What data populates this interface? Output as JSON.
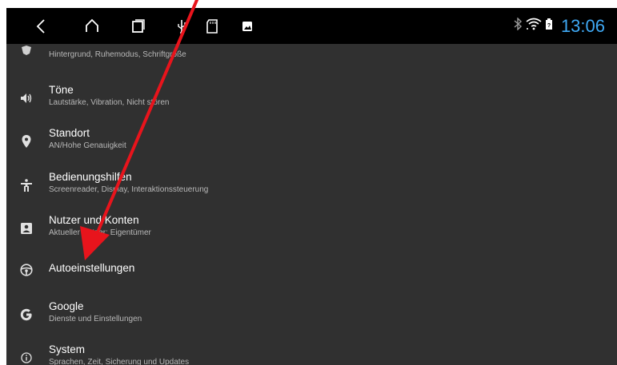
{
  "statusbar": {
    "clock": "13:06",
    "nav_icons": [
      "back-icon",
      "home-icon",
      "recents-icon",
      "usb-icon",
      "sd-card-icon",
      "image-notification-icon"
    ],
    "status_icons": [
      "bluetooth-icon",
      "wifi-icon",
      "battery-icon"
    ]
  },
  "settings": {
    "items": [
      {
        "title": "",
        "subtitle": "Hintergrund, Ruhemodus, Schriftgröße",
        "icon": "display-icon"
      },
      {
        "title": "Töne",
        "subtitle": "Lautstärke, Vibration, Nicht stören",
        "icon": "volume-icon"
      },
      {
        "title": "Standort",
        "subtitle": "AN/Hohe Genauigkeit",
        "icon": "location-icon"
      },
      {
        "title": "Bedienungshilfen",
        "subtitle": "Screenreader, Display, Interaktionssteuerung",
        "icon": "accessibility-icon"
      },
      {
        "title": "Nutzer und Konten",
        "subtitle": "Aktueller Nutzer: Eigentümer",
        "icon": "account-icon"
      },
      {
        "title": "Autoeinstellungen",
        "subtitle": "",
        "icon": "steering-wheel-icon"
      },
      {
        "title": "Google",
        "subtitle": "Dienste und Einstellungen",
        "icon": "google-icon"
      },
      {
        "title": "System",
        "subtitle": "Sprachen, Zeit, Sicherung und Updates",
        "icon": "info-icon"
      }
    ]
  },
  "colors": {
    "background": "#303030",
    "statusbar": "#000000",
    "clock": "#3fa9f5",
    "annotation_arrow": "#e8141c"
  }
}
